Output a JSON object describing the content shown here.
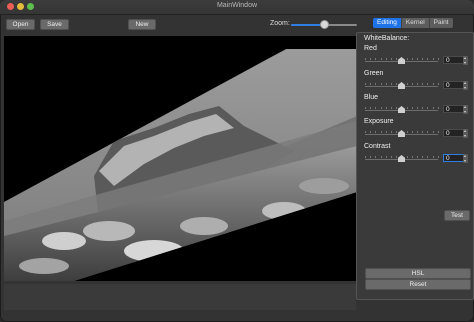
{
  "window": {
    "title": "MainWindow"
  },
  "toolbar": {
    "open_label": "Open",
    "save_label": "Save",
    "new_label": "New",
    "zoom_label": "Zoom:",
    "zoom_fraction": 0.5
  },
  "tabs": [
    {
      "label": "Editing",
      "active": true
    },
    {
      "label": "Kernel",
      "active": false
    },
    {
      "label": "Paint",
      "active": false
    }
  ],
  "editing": {
    "section_title": "WhiteBalance:",
    "sliders": [
      {
        "label": "Red",
        "value": "0",
        "fraction": 0.5
      },
      {
        "label": "Green",
        "value": "0",
        "fraction": 0.5
      },
      {
        "label": "Blue",
        "value": "0",
        "fraction": 0.5
      },
      {
        "label": "Exposure",
        "value": "0",
        "fraction": 0.5
      },
      {
        "label": "Contrast",
        "value": "0",
        "fraction": 0.5
      }
    ],
    "test_label": "Test",
    "hsl_label": "HSL",
    "reset_label": "Reset"
  },
  "colors": {
    "accent": "#1e73e8",
    "traffic_red": "#ec5f57",
    "traffic_yellow": "#e5bd3a",
    "traffic_green": "#5dc04c"
  }
}
